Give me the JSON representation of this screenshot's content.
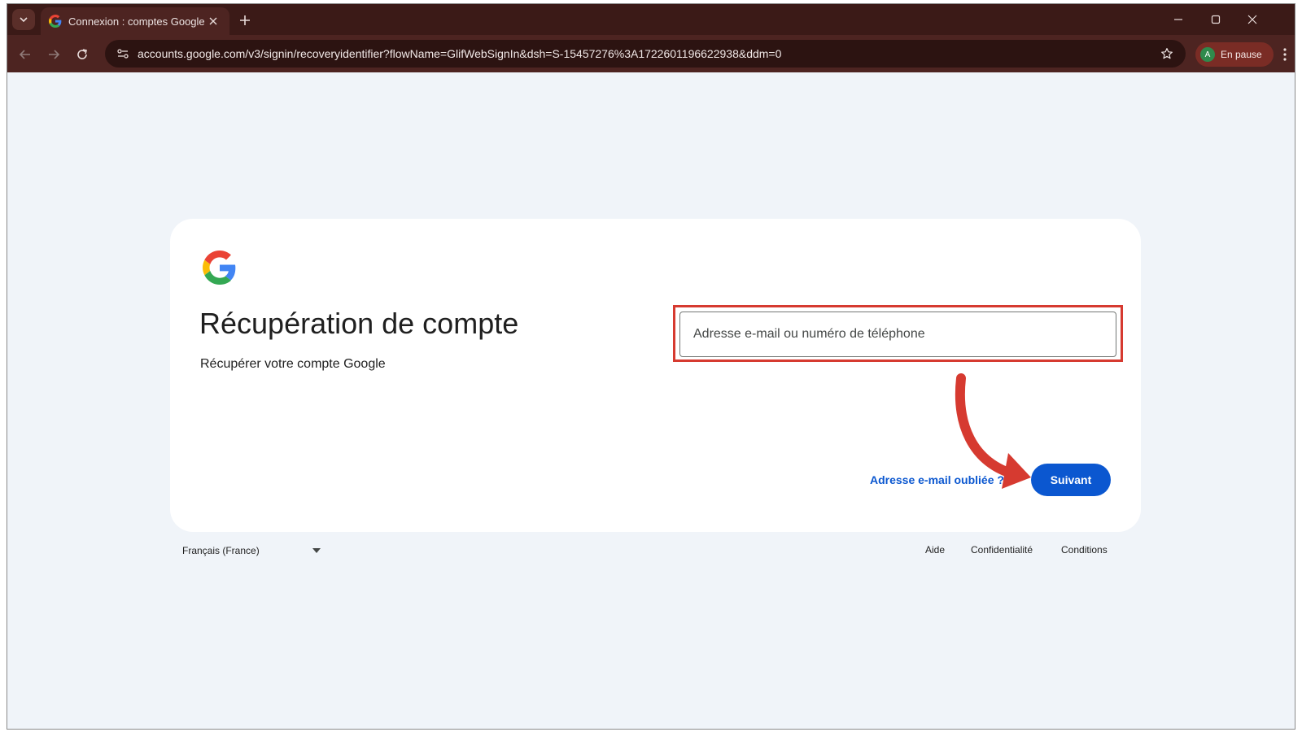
{
  "browser": {
    "tab_title": "Connexion : comptes Google",
    "url": "accounts.google.com/v3/signin/recoveryidentifier?flowName=GlifWebSignIn&dsh=S-15457276%3A1722601196622938&ddm=0",
    "profile_initial": "A",
    "profile_label": "En pause",
    "theme_colors": {
      "tabbar": "#3b1a17",
      "toolbar": "#4d2421",
      "profile_chip": "#7a2c25"
    }
  },
  "page": {
    "heading": "Récupération de compte",
    "subheading": "Récupérer votre compte Google",
    "email_placeholder": "Adresse e-mail ou numéro de téléphone",
    "email_value": "",
    "forgot_link": "Adresse e-mail oubliée ?",
    "next_button": "Suivant",
    "accent_color": "#0b57d0",
    "annotation_color": "#d63a30"
  },
  "footer": {
    "language": "Français (France)",
    "help": "Aide",
    "privacy": "Confidentialité",
    "terms": "Conditions"
  }
}
